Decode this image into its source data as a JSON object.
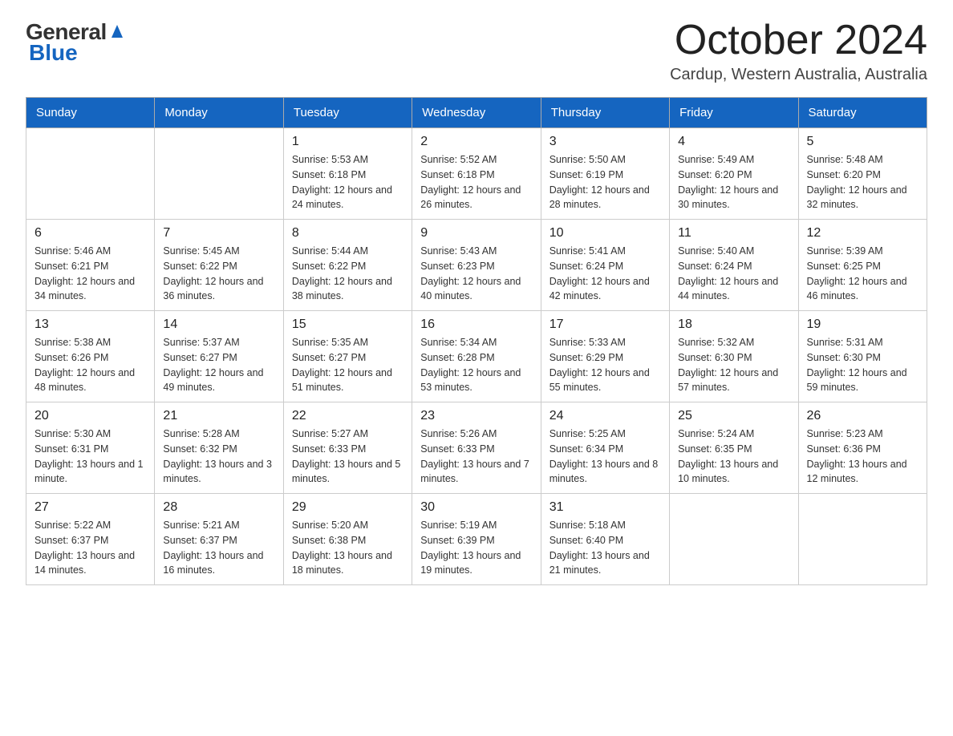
{
  "header": {
    "logo_general": "General",
    "logo_blue": "Blue",
    "title": "October 2024",
    "location": "Cardup, Western Australia, Australia"
  },
  "weekdays": [
    "Sunday",
    "Monday",
    "Tuesday",
    "Wednesday",
    "Thursday",
    "Friday",
    "Saturday"
  ],
  "weeks": [
    [
      {
        "day": "",
        "sunrise": "",
        "sunset": "",
        "daylight": ""
      },
      {
        "day": "",
        "sunrise": "",
        "sunset": "",
        "daylight": ""
      },
      {
        "day": "1",
        "sunrise": "Sunrise: 5:53 AM",
        "sunset": "Sunset: 6:18 PM",
        "daylight": "Daylight: 12 hours and 24 minutes."
      },
      {
        "day": "2",
        "sunrise": "Sunrise: 5:52 AM",
        "sunset": "Sunset: 6:18 PM",
        "daylight": "Daylight: 12 hours and 26 minutes."
      },
      {
        "day": "3",
        "sunrise": "Sunrise: 5:50 AM",
        "sunset": "Sunset: 6:19 PM",
        "daylight": "Daylight: 12 hours and 28 minutes."
      },
      {
        "day": "4",
        "sunrise": "Sunrise: 5:49 AM",
        "sunset": "Sunset: 6:20 PM",
        "daylight": "Daylight: 12 hours and 30 minutes."
      },
      {
        "day": "5",
        "sunrise": "Sunrise: 5:48 AM",
        "sunset": "Sunset: 6:20 PM",
        "daylight": "Daylight: 12 hours and 32 minutes."
      }
    ],
    [
      {
        "day": "6",
        "sunrise": "Sunrise: 5:46 AM",
        "sunset": "Sunset: 6:21 PM",
        "daylight": "Daylight: 12 hours and 34 minutes."
      },
      {
        "day": "7",
        "sunrise": "Sunrise: 5:45 AM",
        "sunset": "Sunset: 6:22 PM",
        "daylight": "Daylight: 12 hours and 36 minutes."
      },
      {
        "day": "8",
        "sunrise": "Sunrise: 5:44 AM",
        "sunset": "Sunset: 6:22 PM",
        "daylight": "Daylight: 12 hours and 38 minutes."
      },
      {
        "day": "9",
        "sunrise": "Sunrise: 5:43 AM",
        "sunset": "Sunset: 6:23 PM",
        "daylight": "Daylight: 12 hours and 40 minutes."
      },
      {
        "day": "10",
        "sunrise": "Sunrise: 5:41 AM",
        "sunset": "Sunset: 6:24 PM",
        "daylight": "Daylight: 12 hours and 42 minutes."
      },
      {
        "day": "11",
        "sunrise": "Sunrise: 5:40 AM",
        "sunset": "Sunset: 6:24 PM",
        "daylight": "Daylight: 12 hours and 44 minutes."
      },
      {
        "day": "12",
        "sunrise": "Sunrise: 5:39 AM",
        "sunset": "Sunset: 6:25 PM",
        "daylight": "Daylight: 12 hours and 46 minutes."
      }
    ],
    [
      {
        "day": "13",
        "sunrise": "Sunrise: 5:38 AM",
        "sunset": "Sunset: 6:26 PM",
        "daylight": "Daylight: 12 hours and 48 minutes."
      },
      {
        "day": "14",
        "sunrise": "Sunrise: 5:37 AM",
        "sunset": "Sunset: 6:27 PM",
        "daylight": "Daylight: 12 hours and 49 minutes."
      },
      {
        "day": "15",
        "sunrise": "Sunrise: 5:35 AM",
        "sunset": "Sunset: 6:27 PM",
        "daylight": "Daylight: 12 hours and 51 minutes."
      },
      {
        "day": "16",
        "sunrise": "Sunrise: 5:34 AM",
        "sunset": "Sunset: 6:28 PM",
        "daylight": "Daylight: 12 hours and 53 minutes."
      },
      {
        "day": "17",
        "sunrise": "Sunrise: 5:33 AM",
        "sunset": "Sunset: 6:29 PM",
        "daylight": "Daylight: 12 hours and 55 minutes."
      },
      {
        "day": "18",
        "sunrise": "Sunrise: 5:32 AM",
        "sunset": "Sunset: 6:30 PM",
        "daylight": "Daylight: 12 hours and 57 minutes."
      },
      {
        "day": "19",
        "sunrise": "Sunrise: 5:31 AM",
        "sunset": "Sunset: 6:30 PM",
        "daylight": "Daylight: 12 hours and 59 minutes."
      }
    ],
    [
      {
        "day": "20",
        "sunrise": "Sunrise: 5:30 AM",
        "sunset": "Sunset: 6:31 PM",
        "daylight": "Daylight: 13 hours and 1 minute."
      },
      {
        "day": "21",
        "sunrise": "Sunrise: 5:28 AM",
        "sunset": "Sunset: 6:32 PM",
        "daylight": "Daylight: 13 hours and 3 minutes."
      },
      {
        "day": "22",
        "sunrise": "Sunrise: 5:27 AM",
        "sunset": "Sunset: 6:33 PM",
        "daylight": "Daylight: 13 hours and 5 minutes."
      },
      {
        "day": "23",
        "sunrise": "Sunrise: 5:26 AM",
        "sunset": "Sunset: 6:33 PM",
        "daylight": "Daylight: 13 hours and 7 minutes."
      },
      {
        "day": "24",
        "sunrise": "Sunrise: 5:25 AM",
        "sunset": "Sunset: 6:34 PM",
        "daylight": "Daylight: 13 hours and 8 minutes."
      },
      {
        "day": "25",
        "sunrise": "Sunrise: 5:24 AM",
        "sunset": "Sunset: 6:35 PM",
        "daylight": "Daylight: 13 hours and 10 minutes."
      },
      {
        "day": "26",
        "sunrise": "Sunrise: 5:23 AM",
        "sunset": "Sunset: 6:36 PM",
        "daylight": "Daylight: 13 hours and 12 minutes."
      }
    ],
    [
      {
        "day": "27",
        "sunrise": "Sunrise: 5:22 AM",
        "sunset": "Sunset: 6:37 PM",
        "daylight": "Daylight: 13 hours and 14 minutes."
      },
      {
        "day": "28",
        "sunrise": "Sunrise: 5:21 AM",
        "sunset": "Sunset: 6:37 PM",
        "daylight": "Daylight: 13 hours and 16 minutes."
      },
      {
        "day": "29",
        "sunrise": "Sunrise: 5:20 AM",
        "sunset": "Sunset: 6:38 PM",
        "daylight": "Daylight: 13 hours and 18 minutes."
      },
      {
        "day": "30",
        "sunrise": "Sunrise: 5:19 AM",
        "sunset": "Sunset: 6:39 PM",
        "daylight": "Daylight: 13 hours and 19 minutes."
      },
      {
        "day": "31",
        "sunrise": "Sunrise: 5:18 AM",
        "sunset": "Sunset: 6:40 PM",
        "daylight": "Daylight: 13 hours and 21 minutes."
      },
      {
        "day": "",
        "sunrise": "",
        "sunset": "",
        "daylight": ""
      },
      {
        "day": "",
        "sunrise": "",
        "sunset": "",
        "daylight": ""
      }
    ]
  ]
}
